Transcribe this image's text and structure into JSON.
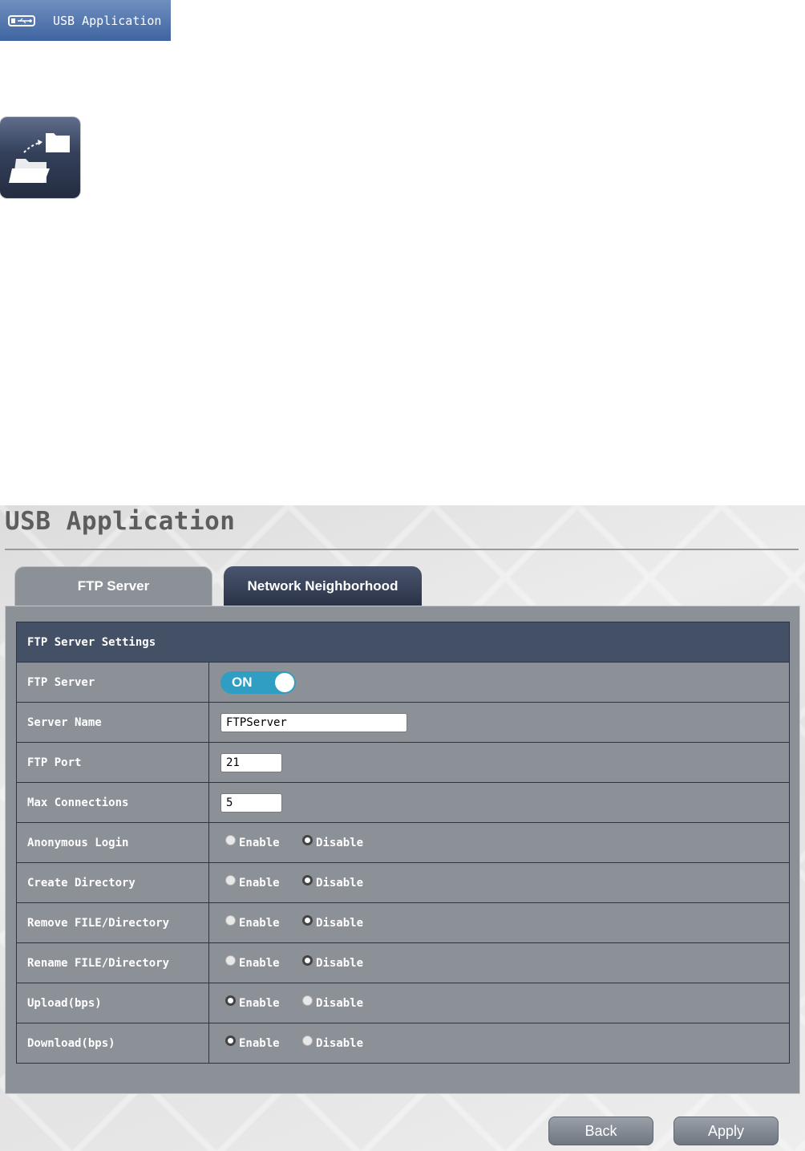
{
  "menu": {
    "label": "USB Application",
    "icon": "usb-drive-icon"
  },
  "tile_icon": "folder-transfer-icon",
  "page": {
    "title": "USB Application"
  },
  "tabs": [
    {
      "label": "FTP Server",
      "active": true
    },
    {
      "label": "Network Neighborhood",
      "active": false
    }
  ],
  "settings": {
    "header": "FTP Server Settings",
    "ftp_server": {
      "label": "FTP Server",
      "toggle": "ON"
    },
    "server_name": {
      "label": "Server Name",
      "value": "FTPServer"
    },
    "ftp_port": {
      "label": "FTP Port",
      "value": "21"
    },
    "max_connections": {
      "label": "Max Connections",
      "value": "5"
    },
    "enable_label": "Enable",
    "disable_label": "Disable",
    "radio_rows": [
      {
        "label": "Anonymous Login",
        "selected": "Disable"
      },
      {
        "label": "Create Directory",
        "selected": "Disable"
      },
      {
        "label": "Remove FILE/Directory",
        "selected": "Disable"
      },
      {
        "label": "Rename FILE/Directory",
        "selected": "Disable"
      },
      {
        "label": "Upload(bps)",
        "selected": "Enable"
      },
      {
        "label": "Download(bps)",
        "selected": "Enable"
      }
    ]
  },
  "buttons": {
    "back": "Back",
    "apply": "Apply"
  },
  "colors": {
    "menu_blue": "#4a6ea8",
    "toggle_on": "#2f9ec2",
    "table_header": "#445066",
    "table_body": "#8c9197"
  }
}
